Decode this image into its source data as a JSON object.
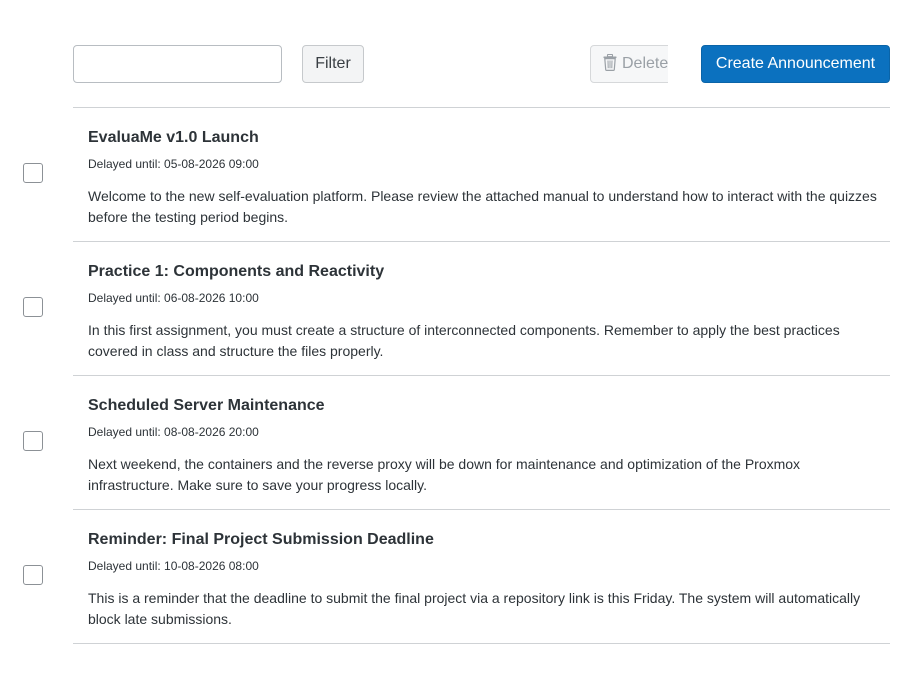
{
  "toolbar": {
    "filter_input_value": "",
    "filter_input_placeholder": "",
    "filter_label": "Filter",
    "delete_label": "Delete",
    "create_label": "Create Announcement"
  },
  "announcements": [
    {
      "title": "EvaluaMe v1.0 Launch",
      "delayed": "Delayed until: 05-08-2026 09:00",
      "body": "Welcome to the new self-evaluation platform. Please review the attached manual to understand how to interact with the quizzes before the testing period begins."
    },
    {
      "title": "Practice 1: Components and Reactivity",
      "delayed": "Delayed until: 06-08-2026 10:00",
      "body": "In this first assignment, you must create a structure of interconnected components. Remember to apply the best practices covered in class and structure the files properly."
    },
    {
      "title": "Scheduled Server Maintenance",
      "delayed": "Delayed until: 08-08-2026 20:00",
      "body": "Next weekend, the containers and the reverse proxy will be down for maintenance and optimization of the Proxmox infrastructure. Make sure to save your progress locally."
    },
    {
      "title": "Reminder: Final Project Submission Deadline",
      "delayed": "Delayed until: 10-08-2026 08:00",
      "body": "This is a reminder that the deadline to submit the final project via a repository link is this Friday. The system will automatically block late submissions."
    }
  ],
  "colors": {
    "primary": "#0b71bf",
    "border": "#cfd2d5",
    "text": "#2d3338",
    "disabled_text": "#9aa0a6"
  },
  "icons": {
    "delete": "trash-icon"
  }
}
